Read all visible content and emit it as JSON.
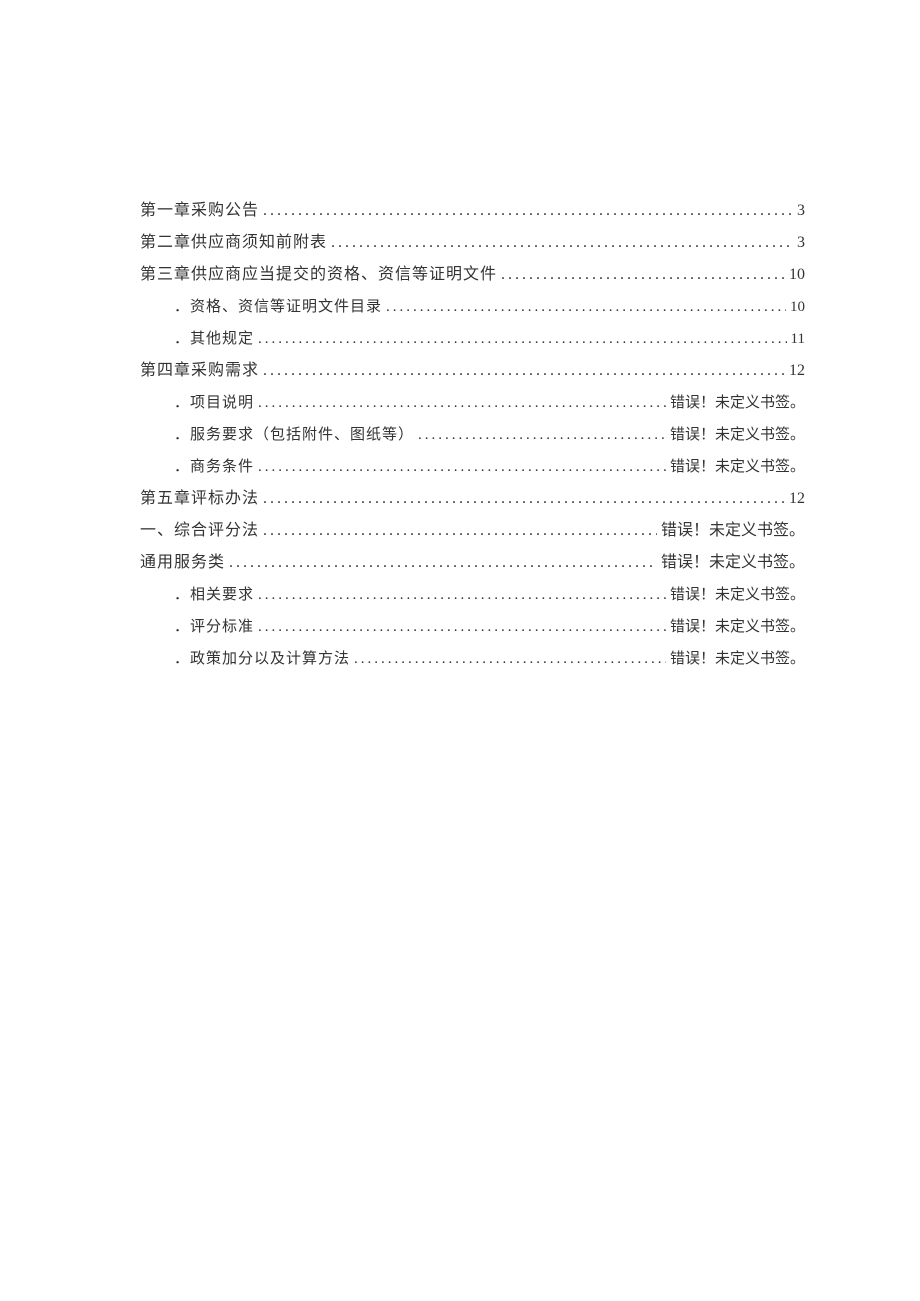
{
  "toc": [
    {
      "level": 1,
      "title": "第一章采购公告",
      "page": "3"
    },
    {
      "level": 1,
      "title": "第二章供应商须知前附表",
      "page": "3"
    },
    {
      "level": 1,
      "title": "第三章供应商应当提交的资格、资信等证明文件",
      "page": "10"
    },
    {
      "level": 2,
      "title": "．资格、资信等证明文件目录",
      "page": "10"
    },
    {
      "level": 2,
      "title": "．其他规定",
      "page": "11"
    },
    {
      "level": 1,
      "title": "第四章采购需求",
      "page": "12"
    },
    {
      "level": 2,
      "title": "．项目说明",
      "page": "错误！未定义书签。"
    },
    {
      "level": 2,
      "title": "．服务要求（包括附件、图纸等）",
      "page": "错误！未定义书签。"
    },
    {
      "level": 2,
      "title": "．商务条件",
      "page": "错误！未定义书签。"
    },
    {
      "level": 1,
      "title": "第五章评标办法",
      "page": "12"
    },
    {
      "level": 1,
      "title": "一、综合评分法",
      "page": "错误！未定义书签。"
    },
    {
      "level": 1,
      "title": "通用服务类",
      "page": "错误！未定义书签。"
    },
    {
      "level": 2,
      "title": "．相关要求",
      "page": "错误！未定义书签。"
    },
    {
      "level": 2,
      "title": "．评分标准",
      "page": "错误！未定义书签。"
    },
    {
      "level": 2,
      "title": "．政策加分以及计算方法",
      "page": "错误！未定义书签。"
    }
  ]
}
